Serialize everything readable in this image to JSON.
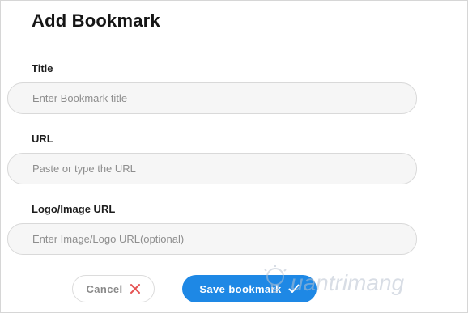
{
  "dialog": {
    "title": "Add Bookmark"
  },
  "fields": {
    "title": {
      "label": "Title",
      "placeholder": "Enter Bookmark title",
      "value": ""
    },
    "url": {
      "label": "URL",
      "placeholder": "Paste or type the URL",
      "value": ""
    },
    "logo": {
      "label": "Logo/Image URL",
      "placeholder": "Enter Image/Logo URL(optional)",
      "value": ""
    }
  },
  "buttons": {
    "cancel": {
      "label": "Cancel",
      "icon": "close-icon",
      "icon_color": "#e55353"
    },
    "save": {
      "label": "Save bookmark",
      "icon": "check-icon",
      "color": "#1e88e5"
    }
  },
  "watermark": {
    "text": "uantrimang",
    "icon": "bulb-icon"
  }
}
